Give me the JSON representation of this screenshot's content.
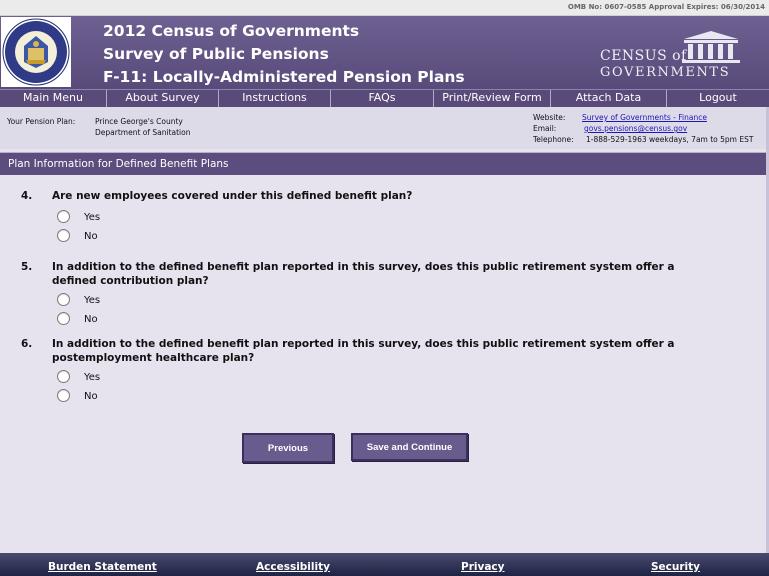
{
  "omb": {
    "text": "OMB No:  0607-0585  Approval Expires:  06/30/2014"
  },
  "header": {
    "line1": "2012 Census of Governments",
    "line2": "Survey of Public Pensions",
    "line3": "F-11:  Locally-Administered Pension Plans",
    "logo_line1": "CENSUS of",
    "logo_line2": "GOVERNMENTS",
    "seal_text_top": "U.S. DEPARTMENT OF COMMERCE",
    "seal_text_bottom": "BUREAU OF THE CENSUS"
  },
  "nav": [
    {
      "label": "Main Menu",
      "width": 107
    },
    {
      "label": "About Survey",
      "width": 112
    },
    {
      "label": "Instructions",
      "width": 112
    },
    {
      "label": "FAQs",
      "width": 103
    },
    {
      "label": "Print/Review Form",
      "width": 117
    },
    {
      "label": "Attach Data",
      "width": 116
    },
    {
      "label": "Logout",
      "width": 102
    }
  ],
  "info": {
    "plan_label": "Your Pension Plan:",
    "plan_line1": "Prince George's County",
    "plan_line2": "Department of Sanitation",
    "website_label": "Website:",
    "website_value": "Survey of Governments - Finance",
    "email_label": "Email:",
    "email_value": "govs.pensions@census.gov",
    "telephone_label": "Telephone:",
    "telephone_value": "1-888-529-1963  weekdays, 7am to 5pm EST"
  },
  "section": {
    "title": "Plan Information for Defined Benefit Plans"
  },
  "questions": [
    {
      "num": "4.",
      "text": "Are new employees covered under this defined benefit plan?",
      "options": [
        "Yes",
        "No"
      ]
    },
    {
      "num": "5.",
      "text": "In addition to the defined benefit plan reported in this survey, does this public retirement system offer a defined contribution plan?",
      "options": [
        "Yes",
        "No"
      ]
    },
    {
      "num": "6.",
      "text": "In addition to the defined benefit plan reported in this survey, does this public retirement system offer a postemployment healthcare plan?",
      "options": [
        "Yes",
        "No"
      ]
    }
  ],
  "buttons": {
    "previous": "Previous",
    "save_continue": "Save and Continue"
  },
  "footer": {
    "burden": "Burden Statement",
    "accessibility": "Accessibility",
    "privacy": "Privacy",
    "security": "Security"
  },
  "colors": {
    "header_purple": "#584a79",
    "page_bg": "#e6e3ef",
    "link_blue": "#1d16b8",
    "footer_navy": "#1e2444"
  }
}
